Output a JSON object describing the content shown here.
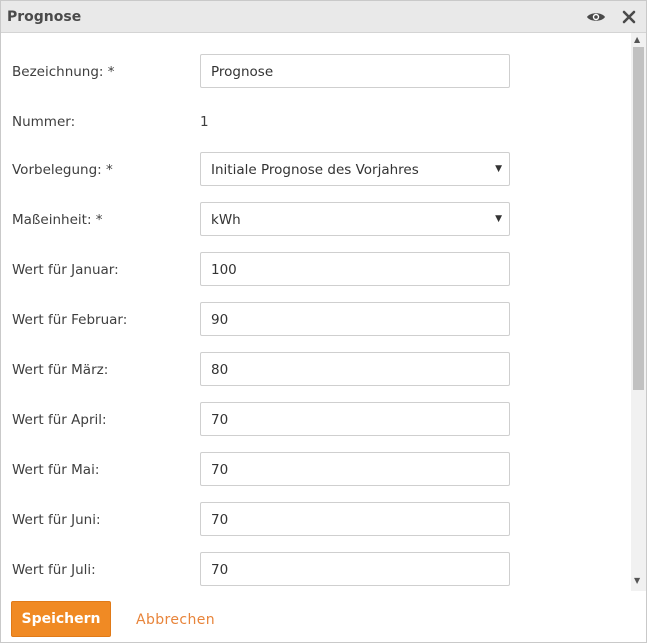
{
  "dialog": {
    "title": "Prognose",
    "view_icon": "eye-icon",
    "close_icon": "close-icon"
  },
  "form": {
    "bezeichnung": {
      "label": "Bezeichnung: *",
      "value": "Prognose"
    },
    "nummer": {
      "label": "Nummer:",
      "value": "1"
    },
    "vorbelegung": {
      "label": "Vorbelegung: *",
      "value": "Initiale Prognose des Vorjahres"
    },
    "masseinheit": {
      "label": "Maßeinheit: *",
      "value": "kWh"
    },
    "months": [
      {
        "label": "Wert für Januar:",
        "value": "100"
      },
      {
        "label": "Wert für Februar:",
        "value": "90"
      },
      {
        "label": "Wert für März:",
        "value": "80"
      },
      {
        "label": "Wert für April:",
        "value": "70"
      },
      {
        "label": "Wert für Mai:",
        "value": "70"
      },
      {
        "label": "Wert für Juni:",
        "value": "70"
      },
      {
        "label": "Wert für Juli:",
        "value": "70"
      }
    ]
  },
  "footer": {
    "save_label": "Speichern",
    "cancel_label": "Abbrechen"
  },
  "colors": {
    "accent": "#f08a24",
    "link": "#e8843a",
    "titlebar": "#e9e9e9"
  }
}
